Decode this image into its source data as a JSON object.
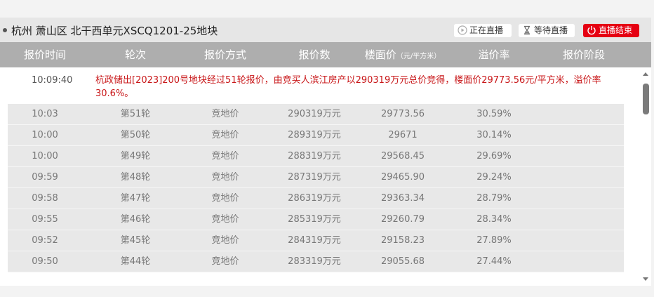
{
  "title": "杭州 萧山区 北干西单元XSCQ1201-25地块",
  "buttons": {
    "live": "正在直播",
    "waiting": "等待直播",
    "ended": "直播结束"
  },
  "colors": {
    "accent_red": "#e50012",
    "message_red": "#c81517",
    "header_gray": "#aeaeae"
  },
  "columns": {
    "time": "报价时间",
    "round": "轮次",
    "method": "报价方式",
    "amount": "报价数",
    "floor_price": "楼面价",
    "floor_price_unit": "（元/平方米）",
    "premium": "溢价率",
    "stage": "报价阶段"
  },
  "first_row": {
    "time": "10:09:40",
    "message": "杭政储出[2023]200号地块经过51轮报价，由竞买人滨江房产以290319万元总价竞得，楼面价29773.56元/平方米，溢价率30.6%。"
  },
  "rows": [
    {
      "time": "10:03",
      "round": "第51轮",
      "method": "竞地价",
      "amount": "290319万元",
      "floor": "29773.56",
      "premium": "30.59%"
    },
    {
      "time": "10:00",
      "round": "第50轮",
      "method": "竞地价",
      "amount": "289319万元",
      "floor": "29671",
      "premium": "30.14%"
    },
    {
      "time": "10:00",
      "round": "第49轮",
      "method": "竞地价",
      "amount": "288319万元",
      "floor": "29568.45",
      "premium": "29.69%"
    },
    {
      "time": "09:59",
      "round": "第48轮",
      "method": "竞地价",
      "amount": "287319万元",
      "floor": "29465.90",
      "premium": "29.24%"
    },
    {
      "time": "09:58",
      "round": "第47轮",
      "method": "竞地价",
      "amount": "286319万元",
      "floor": "29363.34",
      "premium": "28.79%"
    },
    {
      "time": "09:55",
      "round": "第46轮",
      "method": "竞地价",
      "amount": "285319万元",
      "floor": "29260.79",
      "premium": "28.34%"
    },
    {
      "time": "09:52",
      "round": "第45轮",
      "method": "竞地价",
      "amount": "284319万元",
      "floor": "29158.23",
      "premium": "27.89%"
    },
    {
      "time": "09:50",
      "round": "第44轮",
      "method": "竞地价",
      "amount": "283319万元",
      "floor": "29055.68",
      "premium": "27.44%"
    }
  ],
  "icons": {
    "live": "play-circle-icon",
    "waiting": "hourglass-icon",
    "ended": "power-icon"
  }
}
